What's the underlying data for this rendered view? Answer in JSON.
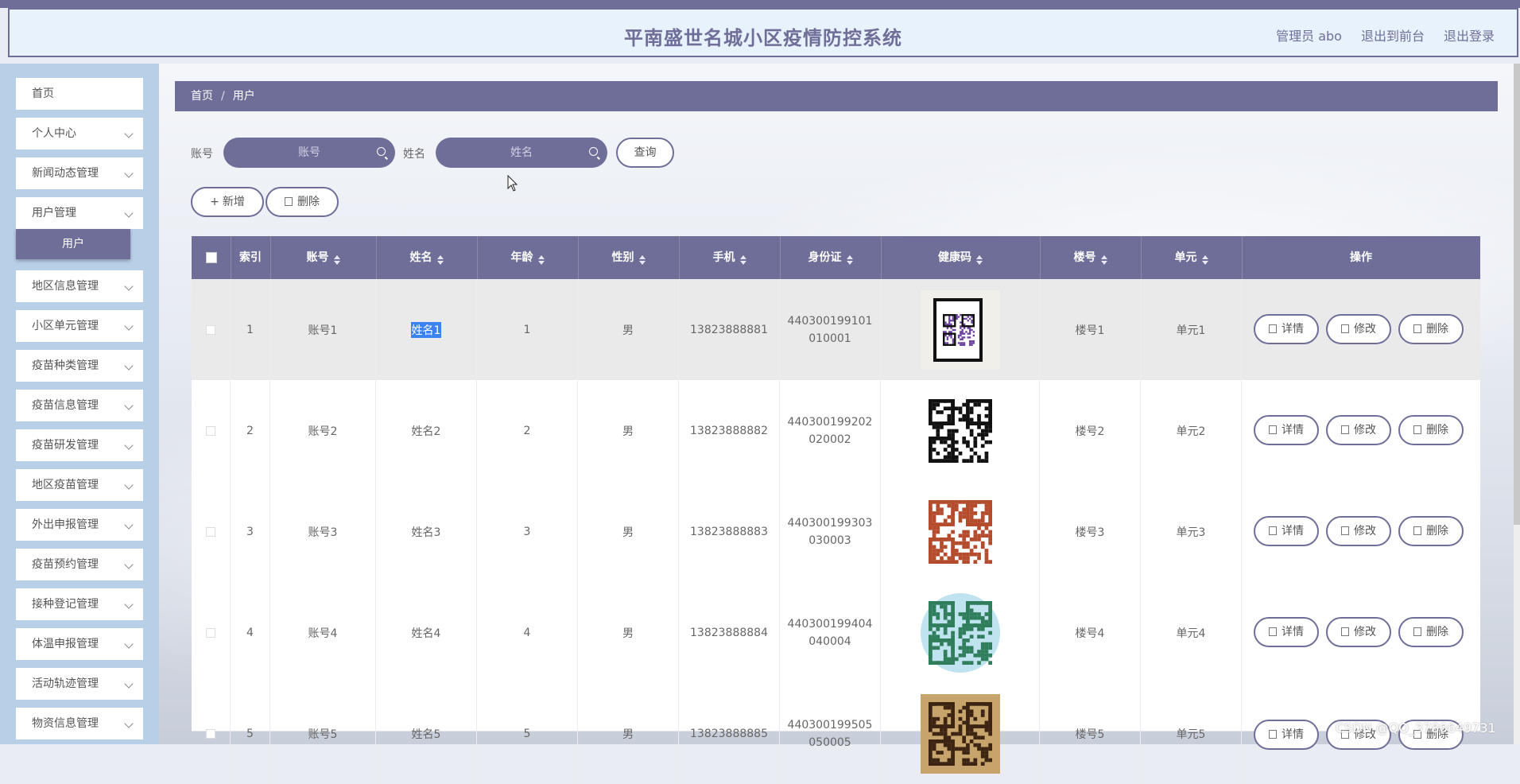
{
  "header": {
    "title": "平南盛世名城小区疫情防控系统",
    "admin_label": "管理员 abo",
    "front_link": "退出到前台",
    "logout_link": "退出登录"
  },
  "sidebar": {
    "items": [
      {
        "label": "首页",
        "chevron": false
      },
      {
        "label": "个人中心",
        "chevron": true
      },
      {
        "label": "新闻动态管理",
        "chevron": true
      },
      {
        "label": "用户管理",
        "chevron": true
      },
      {
        "label": "地区信息管理",
        "chevron": true
      },
      {
        "label": "小区单元管理",
        "chevron": true
      },
      {
        "label": "疫苗种类管理",
        "chevron": true
      },
      {
        "label": "疫苗信息管理",
        "chevron": true
      },
      {
        "label": "疫苗研发管理",
        "chevron": true
      },
      {
        "label": "地区疫苗管理",
        "chevron": true
      },
      {
        "label": "外出申报管理",
        "chevron": true
      },
      {
        "label": "疫苗预约管理",
        "chevron": true
      },
      {
        "label": "接种登记管理",
        "chevron": true
      },
      {
        "label": "体温申报管理",
        "chevron": true
      },
      {
        "label": "活动轨迹管理",
        "chevron": true
      },
      {
        "label": "物资信息管理",
        "chevron": true
      }
    ],
    "active_submenu": "用户"
  },
  "breadcrumb": {
    "home": "首页",
    "sep": "/",
    "current": "用户"
  },
  "search": {
    "account_label": "账号",
    "account_placeholder": "账号",
    "name_label": "姓名",
    "name_placeholder": "姓名",
    "query_button": "查询"
  },
  "toolbar": {
    "add_button": "新增",
    "delete_button": "删除"
  },
  "table": {
    "headers": [
      "索引",
      "账号",
      "姓名",
      "年龄",
      "性别",
      "手机",
      "身份证",
      "健康码",
      "楼号",
      "单元",
      "操作"
    ],
    "actions": {
      "detail": "详情",
      "edit": "修改",
      "delete": "删除"
    },
    "rows": [
      {
        "index": "1",
        "account": "账号1",
        "name": "姓名1",
        "age": "1",
        "gender": "男",
        "phone": "13823888881",
        "id_line1": "440300199101",
        "id_line2": "010001",
        "building": "楼号1",
        "unit": "单元1"
      },
      {
        "index": "2",
        "account": "账号2",
        "name": "姓名2",
        "age": "2",
        "gender": "男",
        "phone": "13823888882",
        "id_line1": "440300199202",
        "id_line2": "020002",
        "building": "楼号2",
        "unit": "单元2"
      },
      {
        "index": "3",
        "account": "账号3",
        "name": "姓名3",
        "age": "3",
        "gender": "男",
        "phone": "13823888883",
        "id_line1": "440300199303",
        "id_line2": "030003",
        "building": "楼号3",
        "unit": "单元3"
      },
      {
        "index": "4",
        "account": "账号4",
        "name": "姓名4",
        "age": "4",
        "gender": "男",
        "phone": "13823888884",
        "id_line1": "440300199404",
        "id_line2": "040004",
        "building": "楼号4",
        "unit": "单元4"
      },
      {
        "index": "5",
        "account": "账号5",
        "name": "姓名5",
        "age": "5",
        "gender": "男",
        "phone": "13823888885",
        "id_line1": "440300199505",
        "id_line2": "050005",
        "building": "楼号5",
        "unit": "单元5"
      }
    ]
  },
  "watermark": "CSDN @QQ_3786649731",
  "colors": {
    "accent": "#6f6e98",
    "header_bg": "#e7f2fc",
    "sidebar_bg": "#b8cfe8",
    "selection": "#3b82f6"
  }
}
